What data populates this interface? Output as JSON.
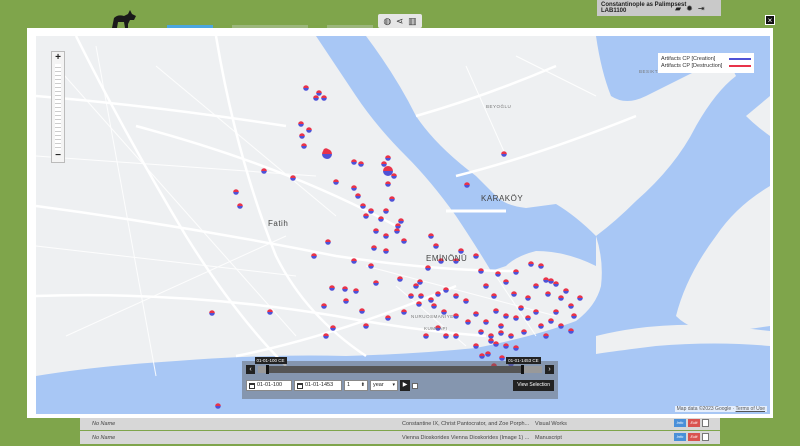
{
  "header": {
    "user_line1": "Constantinople as Palimpsest",
    "user_line2": "LAB1100",
    "close_label": "×"
  },
  "colors": {
    "creation": "#4f52d6",
    "destruction": "#e8334a",
    "water": "#a8c7f5",
    "land": "#eef0f2"
  },
  "map": {
    "legend": {
      "creation": "Artifacts CP [Creation]",
      "destruction": "Artifacts CP [Destruction]"
    },
    "places": [
      "BEYOĞLU",
      "KARAKÖY",
      "Fatih",
      "EMİNÖNÜ",
      "BESIKTA",
      "NURUOSMANİYE",
      "KUMKAPI"
    ],
    "attribution": "Map data ©2023 Google",
    "attribution_link": "Terms of Use",
    "zoom_in": "+",
    "zoom_out": "−"
  },
  "timeline": {
    "start_tag": "01-01-100 CE",
    "end_tag": "01-01-1453 CE",
    "start_date": "01-01-100",
    "end_date": "01-01-1453",
    "step": "1",
    "unit": "year",
    "view_selection": "View Selection",
    "play": "▶",
    "prev": "‹",
    "next": "›",
    "start_fraction": 0.03,
    "end_fraction": 0.93
  },
  "rows": [
    {
      "name": "No Name",
      "desc": "Constantine IX, Christ Pantocrator, and Zoe Porph...",
      "category": "Visual Works",
      "b1": "Info",
      "b2": "Edit"
    },
    {
      "name": "No Name",
      "desc": "Vienna Dioskorides Vienna Dioskorides (Image 1) ...",
      "category": "Manuscript",
      "b1": "Info",
      "b2": "Edit"
    }
  ]
}
